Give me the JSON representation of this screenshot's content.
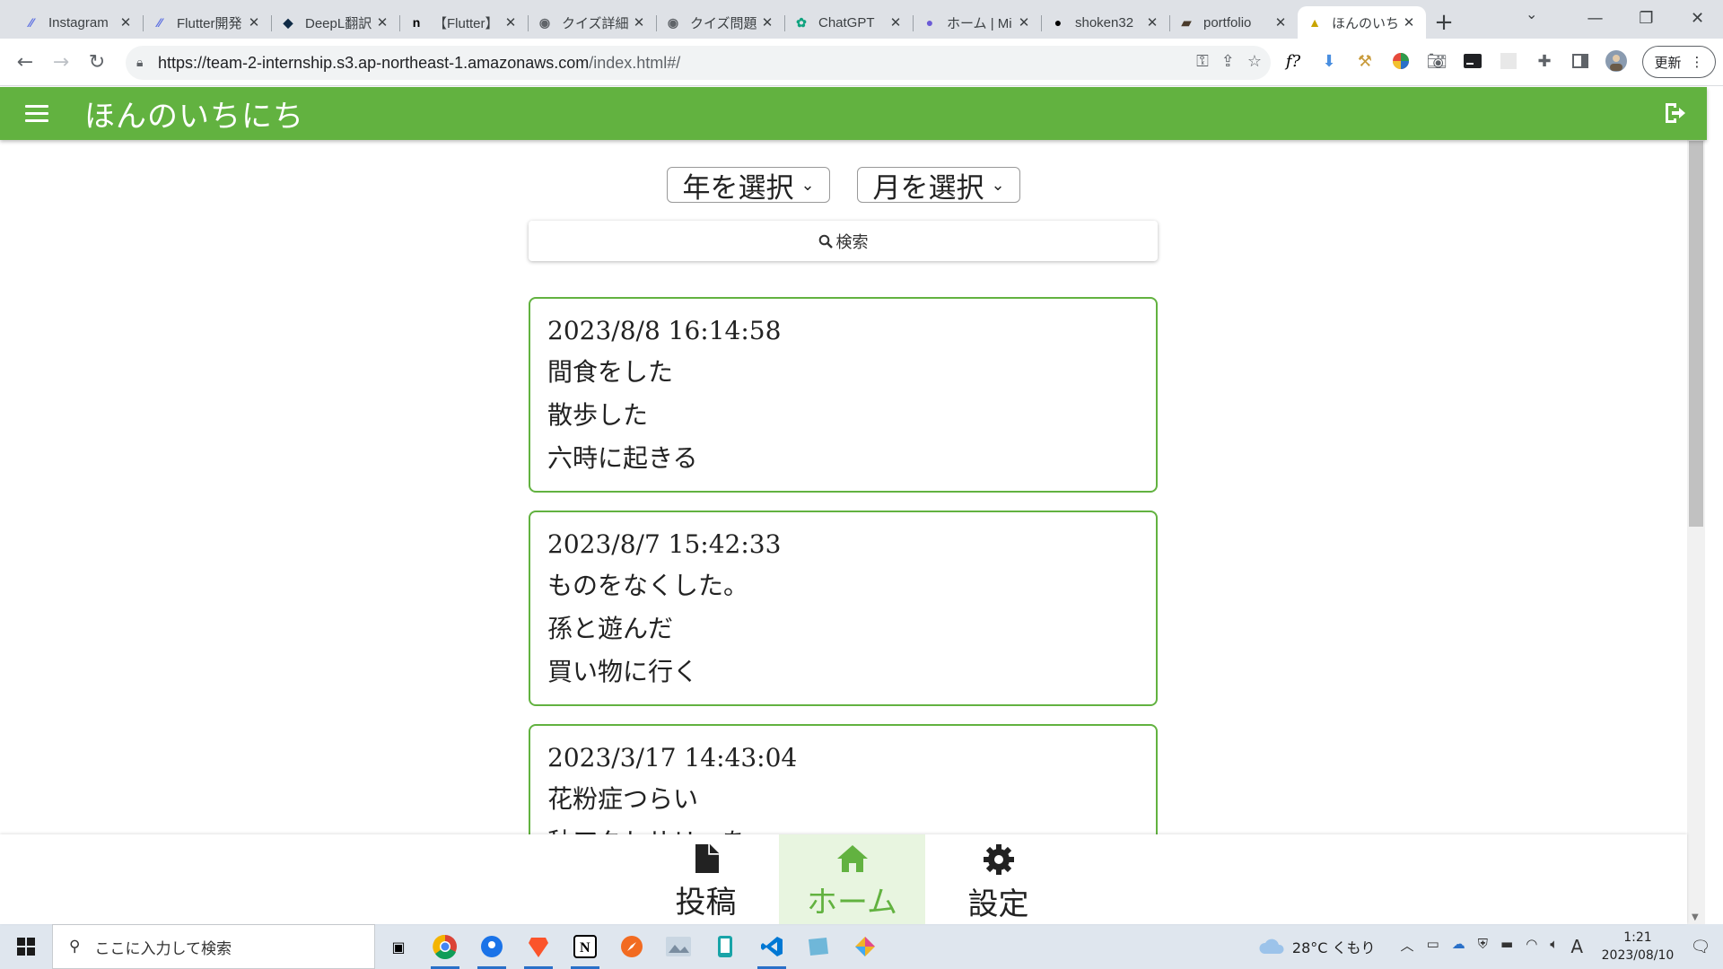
{
  "browser": {
    "tabs": [
      {
        "title": "Instagram",
        "icon": "stripe-slash",
        "color": "#5b6ee1"
      },
      {
        "title": "Flutter開発",
        "icon": "stripe-slash",
        "color": "#5b6ee1"
      },
      {
        "title": "DeepL翻訳",
        "icon": "deepl",
        "color": "#0f2b46"
      },
      {
        "title": "【Flutter】",
        "icon": "notion-n",
        "color": "#000000"
      },
      {
        "title": "クイズ詳細",
        "icon": "globe",
        "color": "#5f6368"
      },
      {
        "title": "クイズ問題",
        "icon": "globe",
        "color": "#5f6368"
      },
      {
        "title": "ChatGPT",
        "icon": "chatgpt",
        "color": "#10a37f"
      },
      {
        "title": "ホーム | Mi",
        "icon": "bubble",
        "color": "#6b5bd6"
      },
      {
        "title": "shoken32",
        "icon": "github",
        "color": "#000000"
      },
      {
        "title": "portfolio",
        "icon": "folder",
        "color": "#4a3b2b"
      },
      {
        "title": "ほんのいち",
        "icon": "app",
        "color": "#c8a400",
        "active": true
      }
    ],
    "url": {
      "host": "https://team-2-internship.s3.ap-northeast-1.amazonaws.com",
      "path": "/index.html#/"
    },
    "update_label": "更新"
  },
  "app": {
    "title": "ほんのいちにち",
    "accent_color": "#62b240",
    "filters": {
      "year": "年を選択",
      "month": "月を選択"
    },
    "search_label": "検索",
    "entries": [
      {
        "date": "2023/8/8 16:14:58",
        "lines": [
          "間食をした",
          "散歩した",
          "六時に起きる"
        ]
      },
      {
        "date": "2023/8/7 15:42:33",
        "lines": [
          "ものをなくした。",
          "孫と遊んだ",
          "買い物に行く"
        ]
      },
      {
        "date": "2023/3/17 14:43:04",
        "lines": [
          "花粉症つらい",
          "秋アクセサリーを...",
          ""
        ]
      }
    ],
    "nav": {
      "post": "投稿",
      "home": "ホーム",
      "settings": "設定",
      "active": "home"
    }
  },
  "taskbar": {
    "search_placeholder": "ここに入力して検索",
    "weather": "28°C くもり",
    "time": "1:21",
    "date": "2023/08/10",
    "ime": "A"
  }
}
